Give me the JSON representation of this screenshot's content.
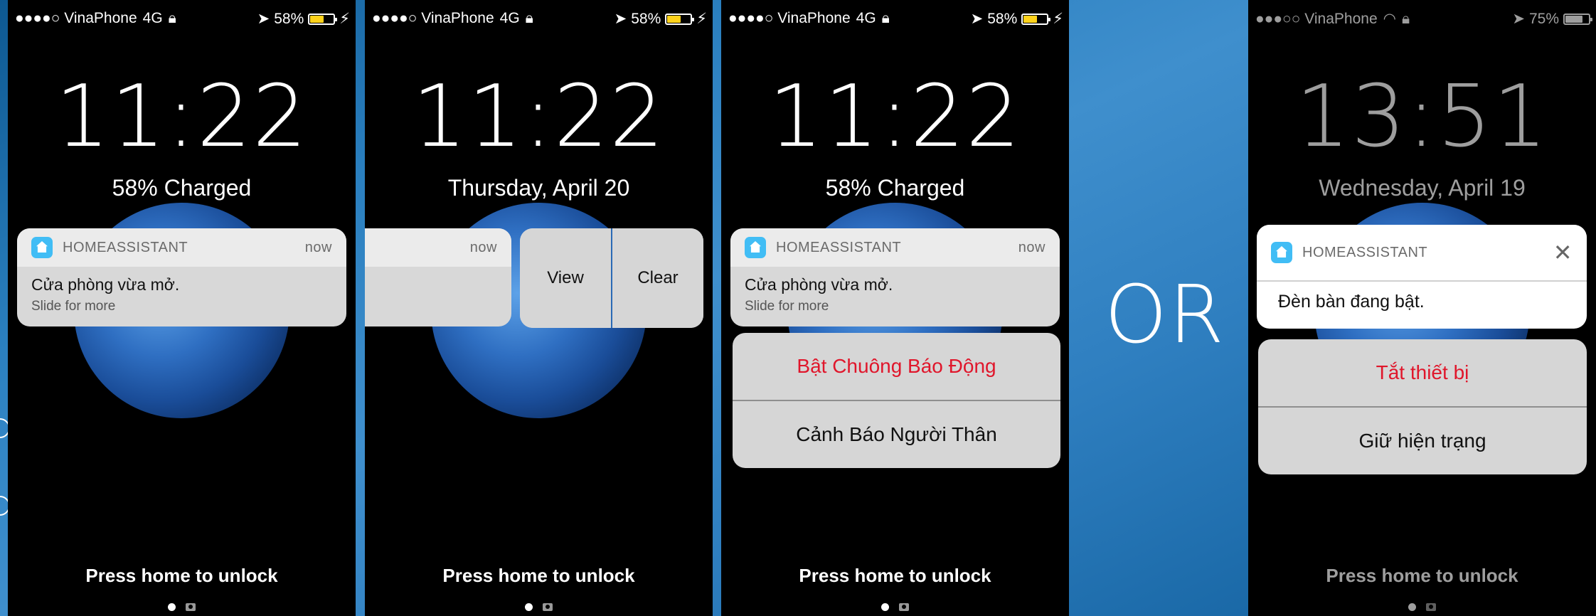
{
  "screens": [
    {
      "status": {
        "carrier": "●●●●○ VinaPhone",
        "network": "4G",
        "battery": "58%"
      },
      "time": "11:22",
      "subtitle": "58% Charged",
      "notification": {
        "app": "HOMEASSISTANT",
        "time": "now",
        "message": "Cửa phòng vừa mở.",
        "hint": "Slide for more"
      },
      "unlock": "Press home to unlock"
    },
    {
      "status": {
        "carrier": "●●●●○ VinaPhone",
        "network": "4G",
        "battery": "58%"
      },
      "time": "11:22",
      "subtitle": "Thursday, April 20",
      "notification": {
        "time": "now",
        "view": "View",
        "clear": "Clear"
      },
      "unlock": "Press home to unlock"
    },
    {
      "status": {
        "carrier": "●●●●○ VinaPhone",
        "network": "4G",
        "battery": "58%"
      },
      "time": "11:22",
      "subtitle": "58% Charged",
      "notification": {
        "app": "HOMEASSISTANT",
        "time": "now",
        "message": "Cửa phòng vừa mở.",
        "hint": "Slide for more"
      },
      "actions": [
        "Bật Chuông Báo Động",
        "Cảnh Báo Người Thân"
      ],
      "unlock": "Press home to unlock"
    },
    {
      "status": {
        "carrier": "●●●○○ VinaPhone",
        "battery": "75%"
      },
      "time": "13:51",
      "subtitle": "Wednesday, April 19",
      "notification": {
        "app": "HOMEASSISTANT",
        "message": "Đèn bàn đang bật."
      },
      "actions": [
        "Tắt thiết bị",
        "Giữ hiện trạng"
      ],
      "unlock": "Press home to unlock"
    }
  ],
  "divider_text": "OR",
  "colors": {
    "battery_yellow": "#ffd21a",
    "action_red": "#e0162b",
    "app_icon": "#41bdf5"
  }
}
